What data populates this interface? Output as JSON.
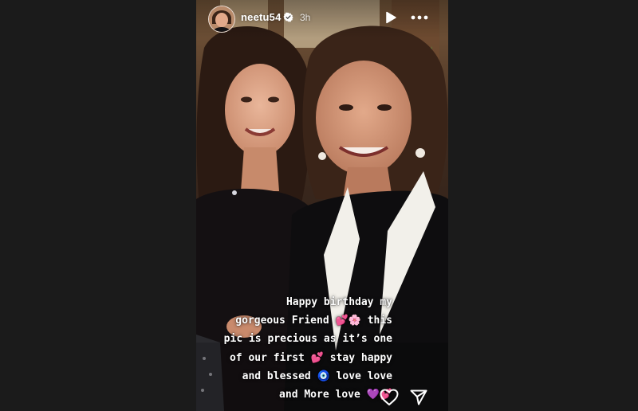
{
  "story": {
    "username": "neetu54",
    "time_ago": "3h",
    "verified": true,
    "caption_lines": [
      "Happy birthday my",
      "gorgeous Friend 💕🌸 this",
      "pic is precious as it’s one",
      "of our first 💕 stay happy",
      "and blessed 🧿 love  love",
      "and More love 💜💕"
    ]
  },
  "icons": {
    "verified": "verified-badge-icon",
    "play": "play-icon",
    "more": "more-options-icon",
    "like": "heart-icon",
    "share": "send-icon"
  },
  "colors": {
    "page_background": "#1b1b1b",
    "icon": "#ffffff"
  }
}
